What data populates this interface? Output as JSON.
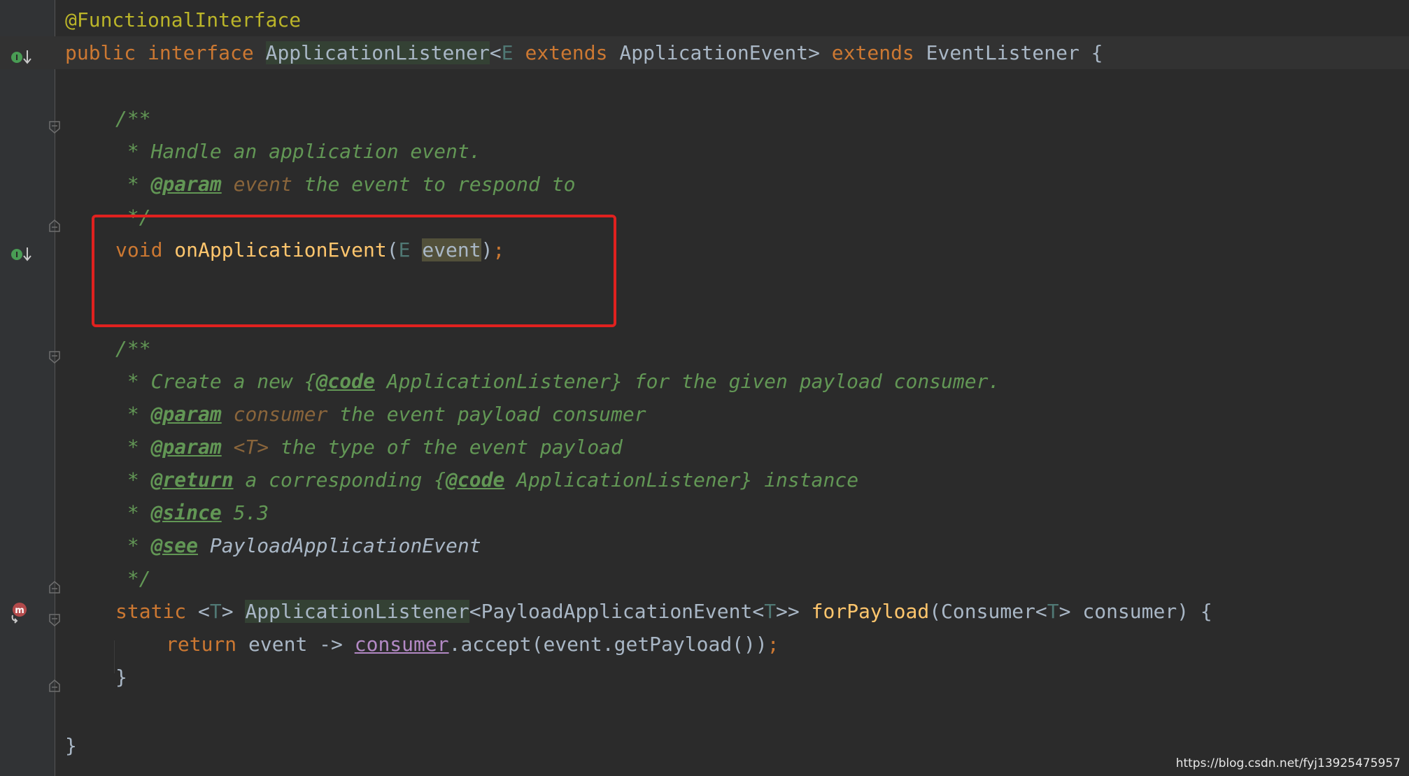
{
  "code": {
    "l1": {
      "annotation": "@FunctionalInterface"
    },
    "l2": {
      "kw_public": "public",
      "kw_interface": "interface",
      "name": "ApplicationListener",
      "lt": "<",
      "tp_E": "E",
      "kw_extends1": "extends",
      "bound": "ApplicationEvent",
      "gt": ">",
      "kw_extends2": "extends",
      "super": "EventListener",
      "brace": "{"
    },
    "l4": {
      "text": "/**"
    },
    "l5": {
      "text": " * Handle an application event."
    },
    "l6": {
      "star": " * ",
      "tag": "@param",
      "param": "event",
      "rest": " the event to respond to"
    },
    "l7": {
      "text": " */"
    },
    "l8": {
      "kw_void": "void",
      "method": "onApplicationEvent",
      "open": "(",
      "tp_E": "E",
      "arg": "event",
      "close": ")",
      "semi": ";"
    },
    "l11": {
      "text": "/**"
    },
    "l12": {
      "star": " * Create a new {",
      "tag": "@code",
      "rest": " ApplicationListener} for the given payload consumer."
    },
    "l13": {
      "star": " * ",
      "tag": "@param",
      "param": "consumer",
      "rest": " the event payload consumer"
    },
    "l14": {
      "star": " * ",
      "tag": "@param",
      "param": "<T>",
      "rest": " the type of the event payload"
    },
    "l15": {
      "star": " * ",
      "tag": "@return",
      "mid": " a corresponding {",
      "tag2": "@code",
      "rest": " ApplicationListener} instance"
    },
    "l16": {
      "star": " * ",
      "tag": "@since",
      "rest": " 5.3"
    },
    "l17": {
      "star": " * ",
      "tag": "@see",
      "rest": " PayloadApplicationEvent"
    },
    "l18": {
      "text": " */"
    },
    "l19": {
      "kw_static": "static",
      "lt": "<",
      "tp_T": "T",
      "gt": ">",
      "ret": "ApplicationListener",
      "generic_open": "<PayloadApplicationEvent<",
      "tp_T2": "T",
      "generic_close": ">>",
      "method": "forPayload",
      "params_open": "(Consumer<",
      "tp_T3": "T",
      "params_close": "> consumer) {"
    },
    "l20": {
      "kw_return": "return",
      "lambda_start": " event -> ",
      "captured": "consumer",
      "call": ".accept(event.getPayload())",
      "semi": ";"
    },
    "l21": {
      "text": "}"
    },
    "l23": {
      "text": "}"
    }
  },
  "gutter": {
    "implemented_icon": "implemented-interface-icon",
    "method_icon": "method-recursion-icon",
    "fold_icon": "fold-marker-icon"
  },
  "watermark": "https://blog.csdn.net/fyj13925475957",
  "colors": {
    "background": "#2b2b2b",
    "keyword": "#cc7832",
    "annotation": "#bbb529",
    "method": "#ffc66d",
    "javadoc": "#629755",
    "highlight_box": "#e0211f"
  }
}
